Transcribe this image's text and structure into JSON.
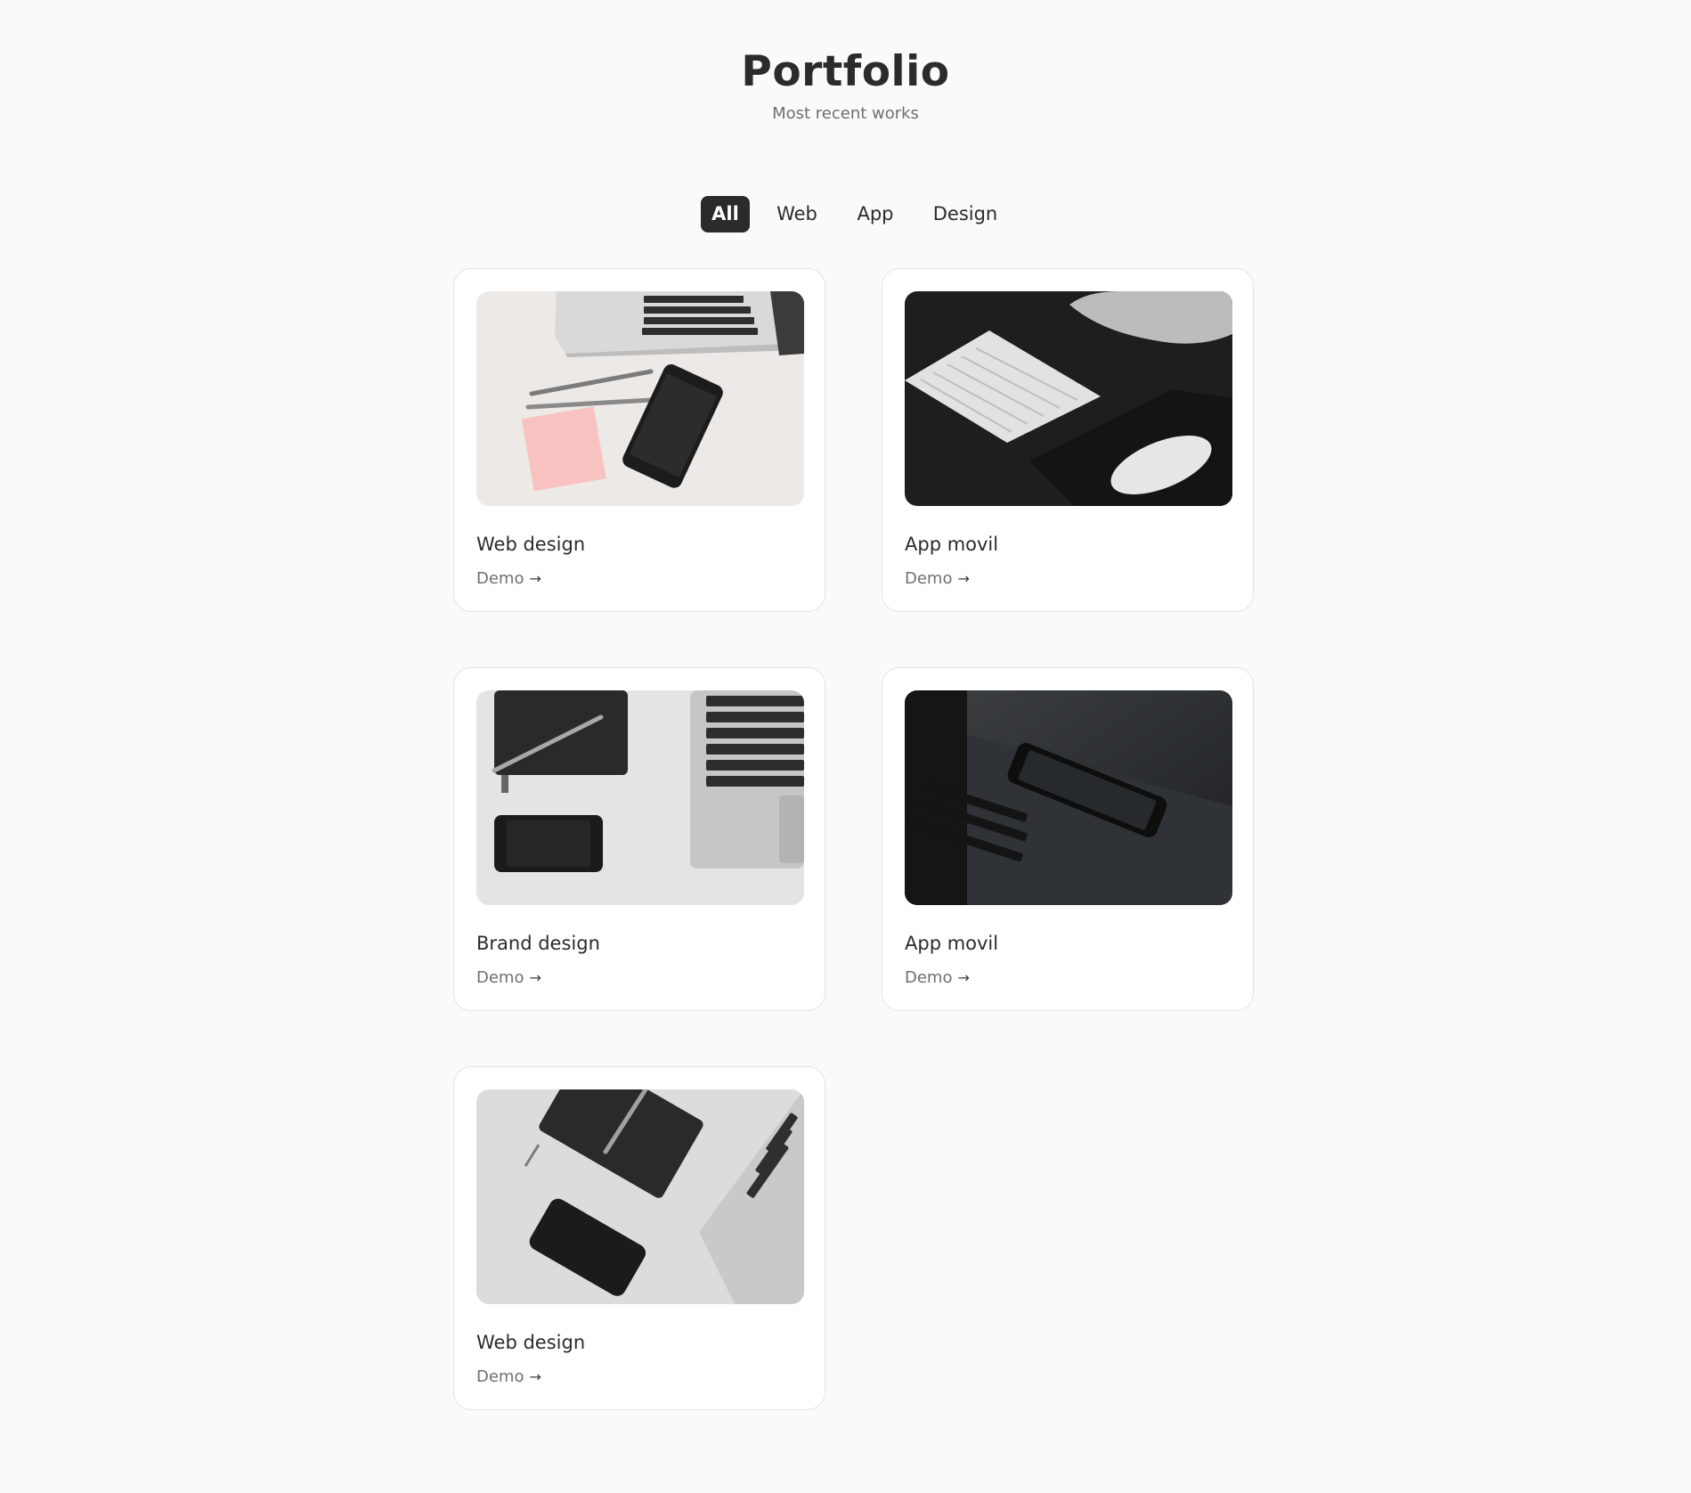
{
  "header": {
    "title": "Portfolio",
    "subtitle": "Most recent works"
  },
  "filters": {
    "all": "All",
    "web": "Web",
    "app": "App",
    "design": "Design",
    "active": "All"
  },
  "cards": [
    {
      "title": "Web design",
      "link": "Demo",
      "image": "laptop-pens-phone-sticky-note"
    },
    {
      "title": "App movil",
      "link": "Demo",
      "image": "keyboard-mouse-dark-desk"
    },
    {
      "title": "Brand design",
      "link": "Demo",
      "image": "notebook-pen-phone-laptop"
    },
    {
      "title": "App movil",
      "link": "Demo",
      "image": "phone-on-laptop-dark"
    },
    {
      "title": "Web design",
      "link": "Demo",
      "image": "notebook-phone-laptop-gray"
    }
  ],
  "icons": {
    "link_arrow": "arrow-right-icon"
  },
  "colors": {
    "background": "#fafafa",
    "text": "#2b2b2b",
    "muted": "#6f6f6f",
    "active_filter_bg": "#2b2b2b",
    "card_border": "#e4e4e4"
  }
}
